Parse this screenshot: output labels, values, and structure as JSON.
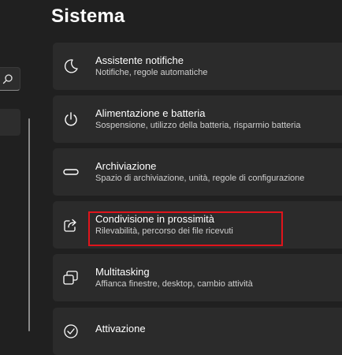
{
  "page": {
    "title": "Sistema"
  },
  "sidebar": {
    "search_icon": "search-icon"
  },
  "settings": [
    {
      "icon": "moon-icon",
      "title": "Assistente notifiche",
      "subtitle": "Notifiche, regole automatiche"
    },
    {
      "icon": "power-icon",
      "title": "Alimentazione e batteria",
      "subtitle": "Sospensione, utilizzo della batteria, risparmio batteria"
    },
    {
      "icon": "storage-icon",
      "title": "Archiviazione",
      "subtitle": "Spazio di archiviazione, unità, regole di configurazione"
    },
    {
      "icon": "share-icon",
      "title": "Condivisione in prossimità",
      "subtitle": "Rilevabilità, percorso dei file ricevuti"
    },
    {
      "icon": "multitasking-icon",
      "title": "Multitasking",
      "subtitle": "Affianca finestre, desktop, cambio attività"
    },
    {
      "icon": "activation-icon",
      "title": "Attivazione",
      "subtitle": ""
    }
  ],
  "colors": {
    "background": "#202020",
    "card": "#2b2b2b",
    "highlight": "#e0141b"
  }
}
